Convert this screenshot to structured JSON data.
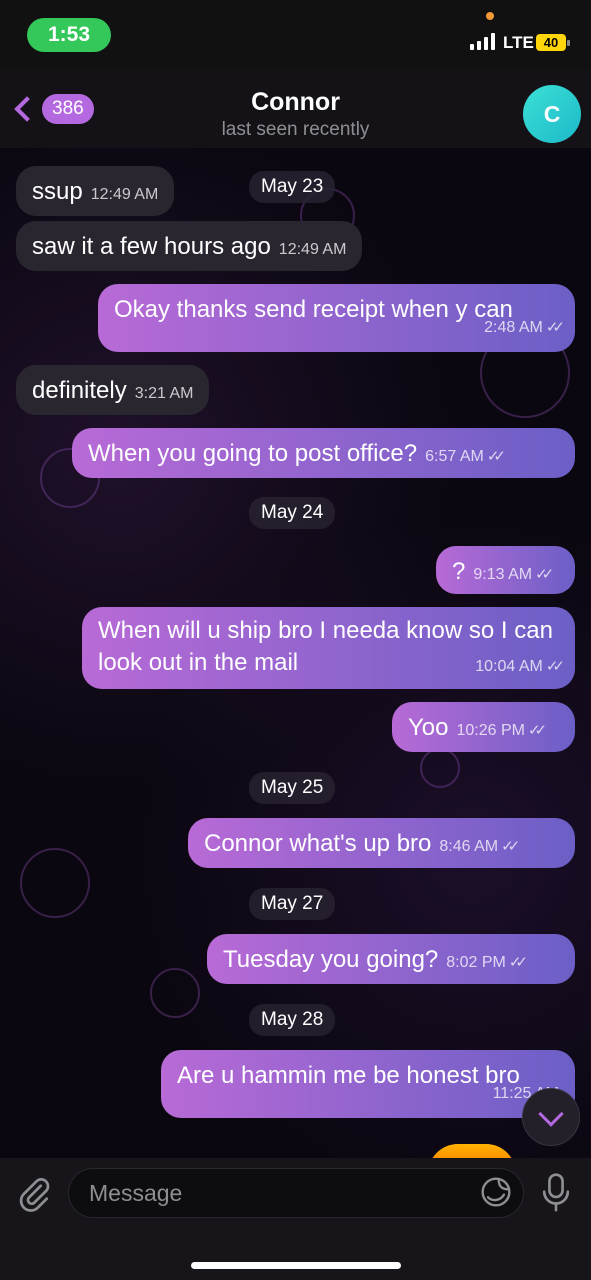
{
  "status_bar": {
    "time": "1:53",
    "network": "LTE",
    "battery": "40"
  },
  "header": {
    "back_count": "386",
    "title": "Connor",
    "subtitle": "last seen recently",
    "avatar_letter": "C"
  },
  "messages": [
    {
      "type": "date",
      "text": "May 23"
    },
    {
      "type": "incoming",
      "text": "ssup",
      "time": "12:49 AM"
    },
    {
      "type": "incoming",
      "text": "saw it a few hours ago",
      "time": "12:49 AM"
    },
    {
      "type": "outgoing",
      "text": "Okay thanks send receipt when y can",
      "time": "2:48 AM"
    },
    {
      "type": "incoming",
      "text": "definitely",
      "time": "3:21 AM"
    },
    {
      "type": "outgoing",
      "text": "When you going to post office?",
      "time": "6:57 AM"
    },
    {
      "type": "date",
      "text": "May 24"
    },
    {
      "type": "outgoing",
      "text": "?",
      "time": "9:13 AM"
    },
    {
      "type": "outgoing",
      "text": "When will u ship bro I needa know so I can look out in the mail",
      "time": "10:04 AM"
    },
    {
      "type": "outgoing",
      "text": "Yoo",
      "time": "10:26 PM"
    },
    {
      "type": "date",
      "text": "May 25"
    },
    {
      "type": "outgoing",
      "text": "Connor what's up bro",
      "time": "8:46 AM"
    },
    {
      "type": "date",
      "text": "May 27"
    },
    {
      "type": "outgoing",
      "text": "Tuesday you going?",
      "time": "8:02 PM"
    },
    {
      "type": "date",
      "text": "May 28"
    },
    {
      "type": "outgoing",
      "text": "Are u hammin me be honest bro",
      "time": "11:25 AM"
    }
  ],
  "input": {
    "placeholder": "Message"
  },
  "icons": {
    "back": "chevron-left-icon",
    "attach": "paperclip-icon",
    "sticker": "sticker-icon",
    "mic": "microphone-icon",
    "scroll": "chevron-down-icon"
  },
  "colors": {
    "accent": "#b569e0",
    "outgoing_start": "#b86ad6",
    "outgoing_end": "#6b5fc6",
    "incoming": "#2a2630",
    "avatar": "#2fcfd0",
    "time_pill": "#34c759"
  }
}
